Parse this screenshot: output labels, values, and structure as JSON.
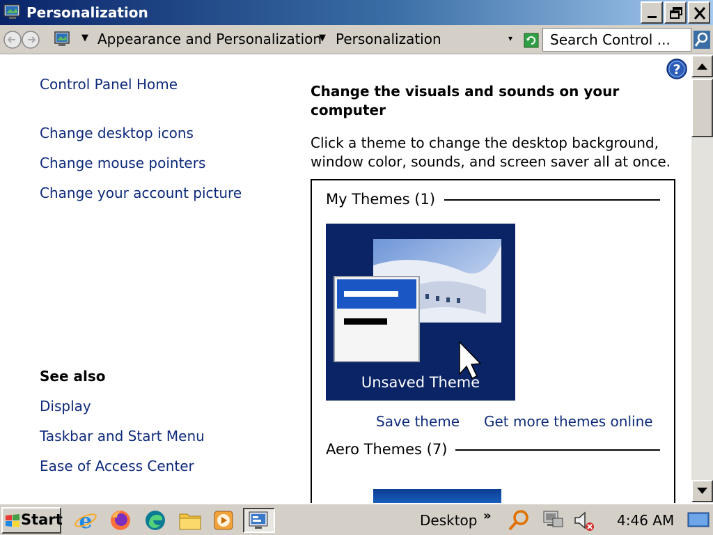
{
  "window": {
    "title": "Personalization",
    "controls": [
      "minimize",
      "restore",
      "close"
    ]
  },
  "addressbar": {
    "breadcrumbs": [
      "Appearance and Personalization",
      "Personalization"
    ],
    "search_placeholder": "Search Control ..."
  },
  "sidebar": {
    "home_link": "Control Panel Home",
    "tasks": [
      "Change desktop icons",
      "Change mouse pointers",
      "Change your account picture"
    ],
    "see_also_heading": "See also",
    "see_also": [
      "Display",
      "Taskbar and Start Menu",
      "Ease of Access Center"
    ]
  },
  "main": {
    "title": "Change the visuals and sounds on your computer",
    "description": "Click a theme to change the desktop background, window color, sounds, and screen saver all at once.",
    "my_themes_label": "My Themes (1)",
    "unsaved_theme_name": "Unsaved Theme",
    "save_theme_link": "Save theme",
    "get_more_link": "Get more themes online",
    "aero_themes_label": "Aero Themes (7)"
  },
  "taskbar": {
    "start_label": "Start",
    "quick_launch_icons": [
      "internet-explorer-icon",
      "firefox-icon",
      "edge-icon",
      "file-explorer-icon",
      "media-player-icon"
    ],
    "active_task_icon": "control-panel-icon",
    "desktop_label": "Desktop",
    "clock": "4:46 AM",
    "tray_icons": [
      "search-icon",
      "network-icon",
      "volume-muted-icon",
      "show-desktop-icon"
    ]
  },
  "colors": {
    "titlebar_start": "#0a246a",
    "titlebar_end": "#a6caf0",
    "link": "#0e2a7a",
    "theme_tile_bg": "#0b2466",
    "chrome": "#d4d0c8"
  }
}
